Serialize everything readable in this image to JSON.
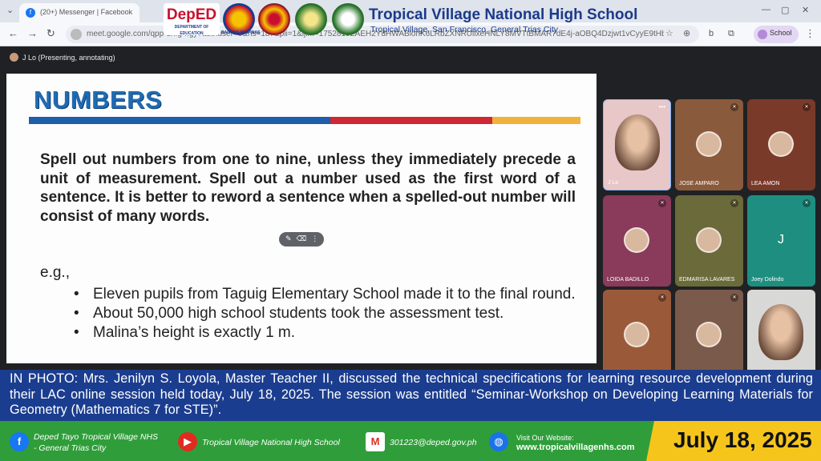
{
  "browser": {
    "tab_title": "(20+) Messenger | Facebook",
    "url": "meet.google.com/qpp-dhfg-hgy?authuser=0&hs=187&pli=1&ijlm=1752819ZAEH2YdHWABlonK6LRbZXNRUlixeHNLY8MVTtBMAR7dE4j-aOBQ4Dzjwt1vCyyE9tHbtG3ES0k3eYfZlywzZv83r...",
    "profile_label": "School"
  },
  "school": {
    "deped_logo_text": "DepED",
    "bagong_pilipinas_text": "BAGONG PILIPINAS",
    "name": "Tropical Village National High School",
    "address": "Tropical Village, San Francisco, General Trias City"
  },
  "meet": {
    "presenter_label": "J Lo (Presenting, annotating)"
  },
  "slide": {
    "title": "NUMBERS",
    "paragraph": "Spell out numbers from one to nine, unless they immediately precede a unit of measurement. Spell out a number used as the first word of a sentence. It is better to reword a sentence when a spelled-out number will consist of many words.",
    "eg_label": "e.g.,",
    "examples": [
      "Eleven pupils from Taguig Elementary School made it to the final round.",
      "About 50,000 high school students took the assessment test.",
      "Malina’s height is exactly 1 m."
    ]
  },
  "participants": [
    {
      "name": "J Lo",
      "kind": "video",
      "bg": "#e8c7c9"
    },
    {
      "name": "JOSE AMPARO",
      "kind": "avatar",
      "bg": "#8a5a3c"
    },
    {
      "name": "LEA AMON",
      "kind": "avatar",
      "bg": "#7a3a2a"
    },
    {
      "name": "LOIDA BADILLO",
      "kind": "avatar",
      "bg": "#8a3a5a"
    },
    {
      "name": "EDMARISA LAVARES",
      "kind": "avatar",
      "bg": "#6a6a3a"
    },
    {
      "name": "Joey Dolindo",
      "kind": "letter",
      "letter": "J",
      "bg": "#1e8e80"
    },
    {
      "name": "",
      "kind": "avatar",
      "bg": "#9a5a3a"
    },
    {
      "name": "",
      "kind": "avatar",
      "bg": "#7a5a4a"
    },
    {
      "name": "",
      "kind": "video",
      "bg": "#d8d8d6"
    }
  ],
  "caption": "IN PHOTO: Mrs. Jenilyn S. Loyola, Master Teacher II, discussed the technical specifications for learning resource development during their LAC online session held today, July 18, 2025. The session was entitled “Seminar-Workshop on Developing Learning Materials for Geometry (Mathematics 7 for STE)”.",
  "footer": {
    "facebook_line1": "Deped Tayo Tropical Village NHS",
    "facebook_line2": "- General Trias City",
    "youtube": "Tropical Village National High School",
    "email": "301223@deped.gov.ph",
    "website_label": "Visit Our Website:",
    "website": "www.tropicalvillagenhs.com",
    "date": "July 18, 2025"
  },
  "colors": {
    "caption_bg": "#1b3d8f",
    "footer_bg": "#2f9e3a",
    "date_bg": "#f5c51b",
    "slide_title": "#1f6bb3"
  }
}
